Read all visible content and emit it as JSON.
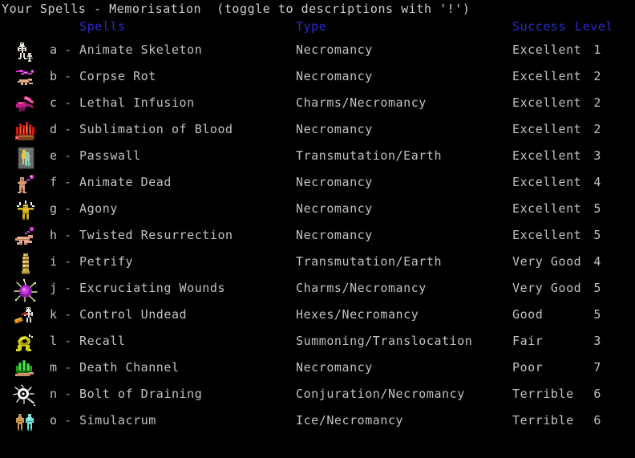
{
  "window": {
    "title": "Your Spells - Memorisation",
    "hint": "(toggle to descriptions with '!')",
    "title_full": "Your Spells - Memorisation  (toggle to descriptions with '!')"
  },
  "colors": {
    "background": "#000000",
    "text": "#c2c2c2",
    "header": "#2b2bcd",
    "title": "#d0d0d0"
  },
  "columns": {
    "spells": "Spells",
    "type": "Type",
    "success": "Success",
    "level": "Level"
  },
  "spells": [
    {
      "letter": "a",
      "separator": "-",
      "name": "Animate Skeleton",
      "type": "Necromancy",
      "success": "Excellent",
      "level": "1",
      "icon": "animate-skeleton-icon"
    },
    {
      "letter": "b",
      "separator": "-",
      "name": "Corpse Rot",
      "type": "Necromancy",
      "success": "Excellent",
      "level": "2",
      "icon": "corpse-rot-icon"
    },
    {
      "letter": "c",
      "separator": "-",
      "name": "Lethal Infusion",
      "type": "Charms/Necromancy",
      "success": "Excellent",
      "level": "2",
      "icon": "lethal-infusion-icon"
    },
    {
      "letter": "d",
      "separator": "-",
      "name": "Sublimation of Blood",
      "type": "Necromancy",
      "success": "Excellent",
      "level": "2",
      "icon": "sublimation-of-blood-icon"
    },
    {
      "letter": "e",
      "separator": "-",
      "name": "Passwall",
      "type": "Transmutation/Earth",
      "success": "Excellent",
      "level": "3",
      "icon": "passwall-icon"
    },
    {
      "letter": "f",
      "separator": "-",
      "name": "Animate Dead",
      "type": "Necromancy",
      "success": "Excellent",
      "level": "4",
      "icon": "animate-dead-icon"
    },
    {
      "letter": "g",
      "separator": "-",
      "name": "Agony",
      "type": "Necromancy",
      "success": "Excellent",
      "level": "5",
      "icon": "agony-icon"
    },
    {
      "letter": "h",
      "separator": "-",
      "name": "Twisted Resurrection",
      "type": "Necromancy",
      "success": "Excellent",
      "level": "5",
      "icon": "twisted-resurrection-icon"
    },
    {
      "letter": "i",
      "separator": "-",
      "name": "Petrify",
      "type": "Transmutation/Earth",
      "success": "Very Good",
      "level": "4",
      "icon": "petrify-icon"
    },
    {
      "letter": "j",
      "separator": "-",
      "name": "Excruciating Wounds",
      "type": "Charms/Necromancy",
      "success": "Very Good",
      "level": "5",
      "icon": "excruciating-wounds-icon"
    },
    {
      "letter": "k",
      "separator": "-",
      "name": "Control Undead",
      "type": "Hexes/Necromancy",
      "success": "Good",
      "level": "5",
      "icon": "control-undead-icon"
    },
    {
      "letter": "l",
      "separator": "-",
      "name": "Recall",
      "type": "Summoning/Translocation",
      "success": "Fair",
      "level": "3",
      "icon": "recall-icon"
    },
    {
      "letter": "m",
      "separator": "-",
      "name": "Death Channel",
      "type": "Necromancy",
      "success": "Poor",
      "level": "7",
      "icon": "death-channel-icon"
    },
    {
      "letter": "n",
      "separator": "-",
      "name": "Bolt of Draining",
      "type": "Conjuration/Necromancy",
      "success": "Terrible",
      "level": "6",
      "icon": "bolt-of-draining-icon"
    },
    {
      "letter": "o",
      "separator": "-",
      "name": "Simulacrum",
      "type": "Ice/Necromancy",
      "success": "Terrible",
      "level": "6",
      "icon": "simulacrum-icon"
    }
  ]
}
